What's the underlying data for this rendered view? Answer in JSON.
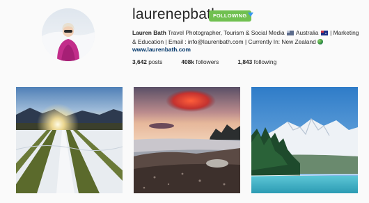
{
  "profile": {
    "username": "laurenepbath",
    "follow_label": "FOLLOWING",
    "full_name": "Lauren Bath",
    "bio_part1": "Travel Photographer, Tourism & Social Media",
    "bio_part2": "Australia",
    "bio_part3": "| Marketing & Education | Email : info@laurenbath.com | Currently In: New Zealand",
    "website": "www.laurenbath.com"
  },
  "stats": {
    "posts_count": "3,642",
    "posts_label": "posts",
    "followers_count": "408k",
    "followers_label": "followers",
    "following_count": "1,843",
    "following_label": "following"
  },
  "photos": [
    {
      "subject": "snowy-field-sunset"
    },
    {
      "subject": "lake-sunset-cloud"
    },
    {
      "subject": "snow-mountain-forest"
    }
  ],
  "colors": {
    "following_button": "#70c050",
    "dropdown_arrow": "#3897f0",
    "link": "#003569"
  }
}
